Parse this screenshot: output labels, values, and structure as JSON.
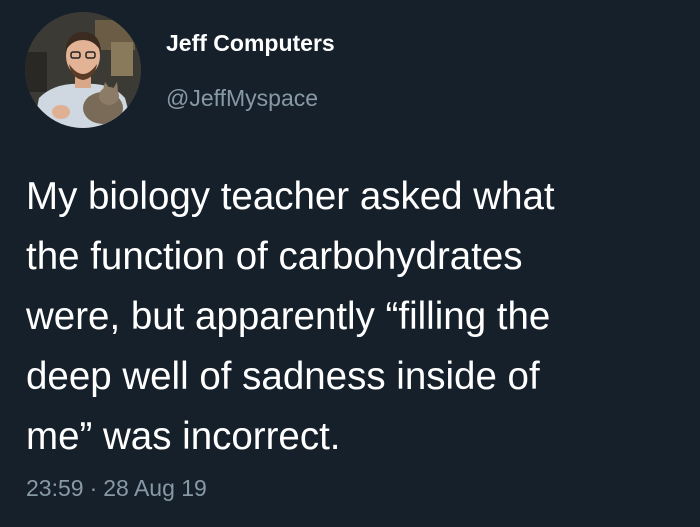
{
  "user": {
    "display_name": "Jeff Computers",
    "handle": "@JeffMyspace",
    "avatar_icon": "profile-photo-man-holding-cat"
  },
  "tweet": {
    "text_lines": [
      "My biology teacher asked what",
      "the function of carbohydrates",
      "were, but apparently “filling the",
      "deep well of sadness inside of",
      "me” was incorrect."
    ],
    "time": "23:59",
    "separator": "·",
    "date": "28 Aug 19"
  },
  "colors": {
    "background": "#15202b",
    "primary_text": "#ffffff",
    "secondary_text": "#8899a6"
  }
}
